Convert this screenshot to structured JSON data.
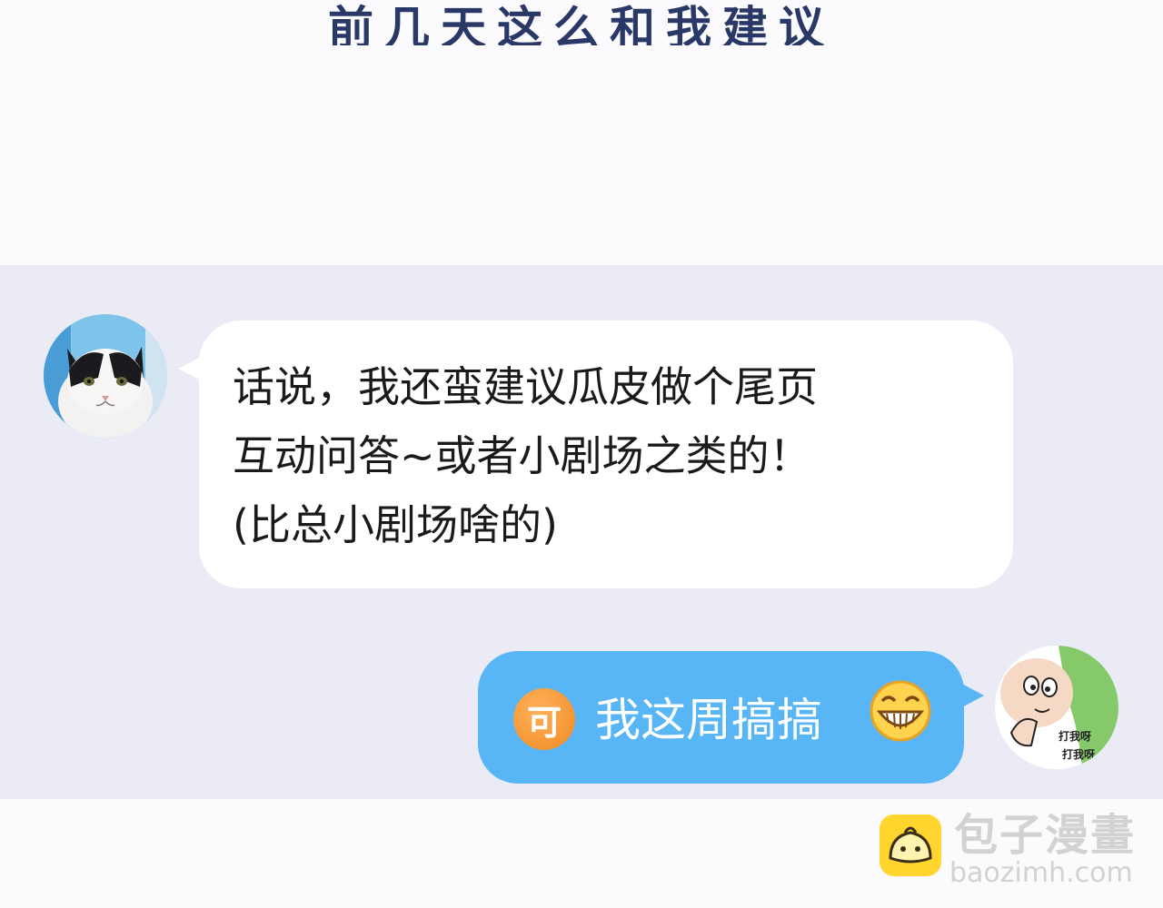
{
  "header": {
    "caption": "前几天这么和我建议"
  },
  "chat": {
    "incoming": {
      "lines": [
        "话说，我还蛮建议瓜皮做个尾页",
        "互动问答~或者小剧场之类的！",
        "(比总小剧场啥的)"
      ]
    },
    "outgoing": {
      "badge": "可",
      "text": "我这周搞搞"
    },
    "right_avatar_caption": [
      "打我呀",
      "打我呀"
    ]
  },
  "watermark": {
    "name": "包子漫畫",
    "url": "baozimh.com"
  },
  "colors": {
    "caption": "#2a3868",
    "panel": "#ebebf5",
    "incoming_bubble": "#ffffff",
    "outgoing_bubble": "#58b5f6",
    "badge": "#f08a22",
    "logo": "#ffd52e"
  },
  "icons": {
    "left_avatar": "cat-avatar-icon",
    "right_avatar": "cartoon-avatar-icon",
    "emoji": "grinning-face-icon",
    "logo": "bun-logo-icon"
  }
}
